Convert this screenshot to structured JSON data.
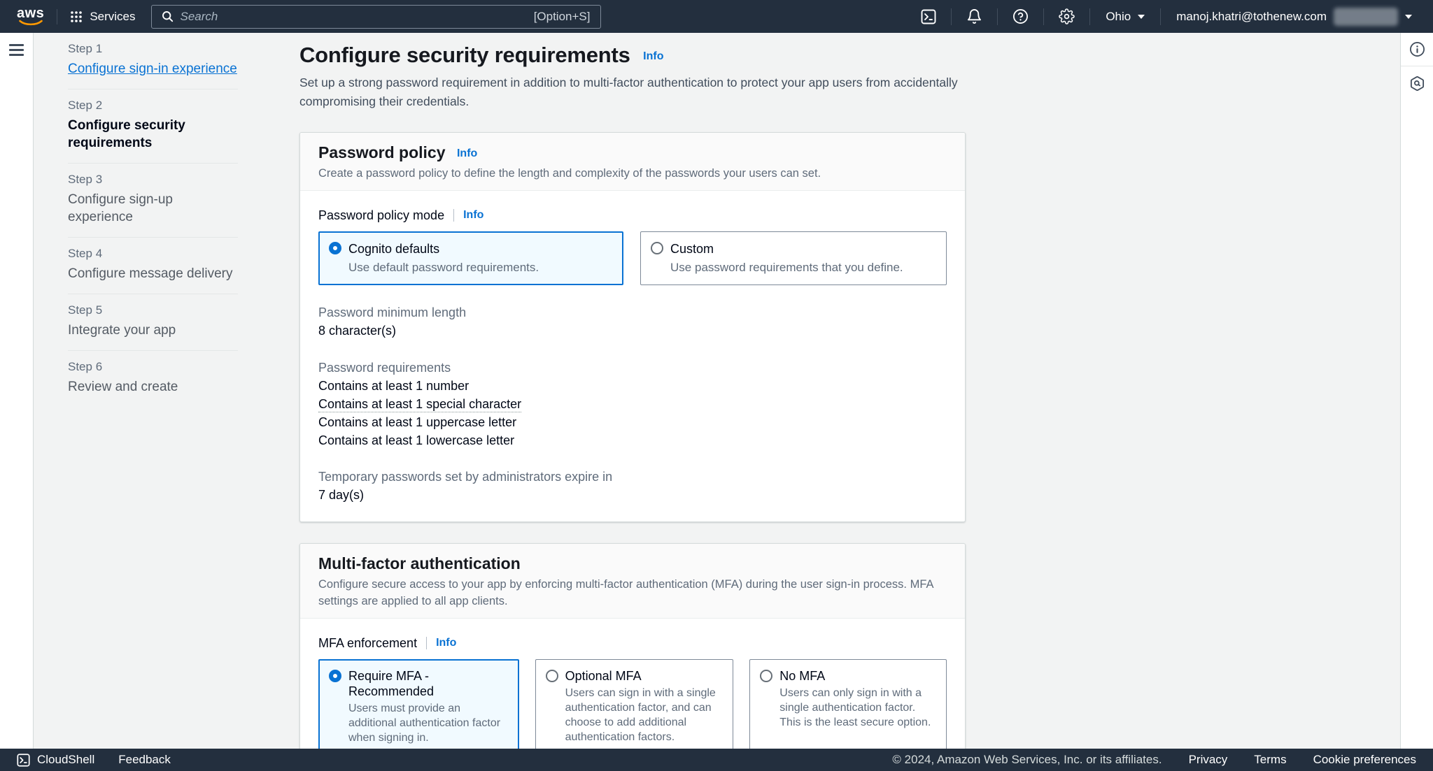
{
  "colors": {
    "topbar_bg": "#232f3e",
    "accent_blue": "#0972d3",
    "content_bg": "#f2f3f3",
    "selected_tile_bg": "#f1faff",
    "logo_smile_orange": "#ff9900"
  },
  "topbar": {
    "logo_text": "aws",
    "services_label": "Services",
    "search_placeholder": "Search",
    "search_shortcut": "[Option+S]",
    "region_label": "Ohio",
    "user_email": "manoj.khatri@tothenew.com",
    "icon_names": [
      "cloudshell-terminal",
      "notifications-bell",
      "help-circle",
      "settings-gear"
    ]
  },
  "wizard": {
    "steps": [
      {
        "step": "Step 1",
        "title": "Configure sign-in experience",
        "state": "link"
      },
      {
        "step": "Step 2",
        "title": "Configure security requirements",
        "state": "current"
      },
      {
        "step": "Step 3",
        "title": "Configure sign-up experience",
        "state": "upcoming"
      },
      {
        "step": "Step 4",
        "title": "Configure message delivery",
        "state": "upcoming"
      },
      {
        "step": "Step 5",
        "title": "Integrate your app",
        "state": "upcoming"
      },
      {
        "step": "Step 6",
        "title": "Review and create",
        "state": "upcoming"
      }
    ]
  },
  "page": {
    "title": "Configure security requirements",
    "info_link": "Info",
    "description": "Set up a strong password requirement in addition to multi-factor authentication to protect your app users from accidentally compromising their credentials."
  },
  "password_policy": {
    "title": "Password policy",
    "info_link": "Info",
    "description": "Create a password policy to define the length and complexity of the passwords your users can set.",
    "mode": {
      "label": "Password policy mode",
      "info_link": "Info",
      "options": [
        {
          "title": "Cognito defaults",
          "description": "Use default password requirements.",
          "selected": true
        },
        {
          "title": "Custom",
          "description": "Use password requirements that you define.",
          "selected": false
        }
      ]
    },
    "min_length": {
      "label": "Password minimum length",
      "value": "8 character(s)"
    },
    "requirements": {
      "label": "Password requirements",
      "items": [
        "Contains at least 1 number",
        "Contains at least 1 special character",
        "Contains at least 1 uppercase letter",
        "Contains at least 1 lowercase letter"
      ]
    },
    "temp_password": {
      "label": "Temporary passwords set by administrators expire in",
      "value": "7 day(s)"
    }
  },
  "mfa": {
    "title": "Multi-factor authentication",
    "description": "Configure secure access to your app by enforcing multi-factor authentication (MFA) during the user sign-in process. MFA settings are applied to all app clients.",
    "enforcement": {
      "label": "MFA enforcement",
      "info_link": "Info",
      "options": [
        {
          "title": "Require MFA - Recommended",
          "description": "Users must provide an additional authentication factor when signing in.",
          "selected": true
        },
        {
          "title": "Optional MFA",
          "description": "Users can sign in with a single authentication factor, and can choose to add additional authentication factors.",
          "selected": false
        },
        {
          "title": "No MFA",
          "description": "Users can only sign in with a single authentication factor. This is the least secure option.",
          "selected": false
        }
      ]
    }
  },
  "footer": {
    "cloudshell_label": "CloudShell",
    "feedback_label": "Feedback",
    "copyright": "© 2024, Amazon Web Services, Inc. or its affiliates.",
    "links": [
      "Privacy",
      "Terms",
      "Cookie preferences"
    ]
  },
  "tools_panel": {
    "icon_names": [
      "info-circle",
      "resources-hexagon"
    ]
  }
}
